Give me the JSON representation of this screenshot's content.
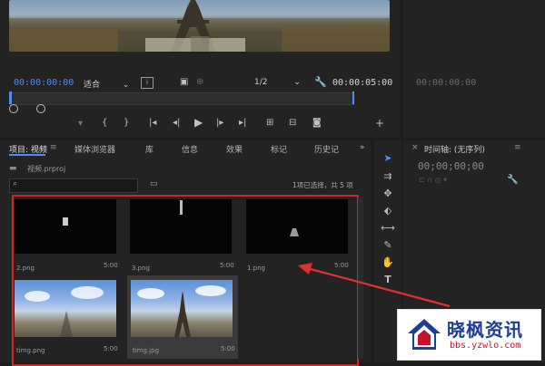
{
  "monitor": {
    "timecode_current": "00:00:00:00",
    "fit_value": "适合",
    "resolution_value": "1/2",
    "timecode_duration": "00:00:05:00"
  },
  "source": {
    "timecode": "00:00:00:00"
  },
  "project": {
    "tabs": [
      "项目: 视频",
      "媒体浏览器",
      "库",
      "信息",
      "效果",
      "标记",
      "历史记"
    ],
    "more": "»",
    "file_name": "视频.prproj",
    "selection_status": "1项已选择，共 5 项",
    "items": [
      {
        "name": "2.png",
        "duration": "5:00"
      },
      {
        "name": "3.png",
        "duration": "5:00"
      },
      {
        "name": "1.png",
        "duration": "5:00"
      },
      {
        "name": "timg.png",
        "duration": "5:00"
      },
      {
        "name": "timg.jpg",
        "duration": "5:00"
      }
    ]
  },
  "timeline": {
    "title": "时间轴: (无序列)",
    "timecode": "00;00;00;00"
  },
  "watermark": {
    "brand": "晓枫资讯",
    "url": "bbs.yzwlo.com"
  },
  "colors": {
    "accent_blue": "#4e8df3",
    "highlight_red": "#d02626",
    "arrow_red": "#e03030",
    "watermark_red": "#c8102e",
    "watermark_blue": "#1e3f8f"
  }
}
